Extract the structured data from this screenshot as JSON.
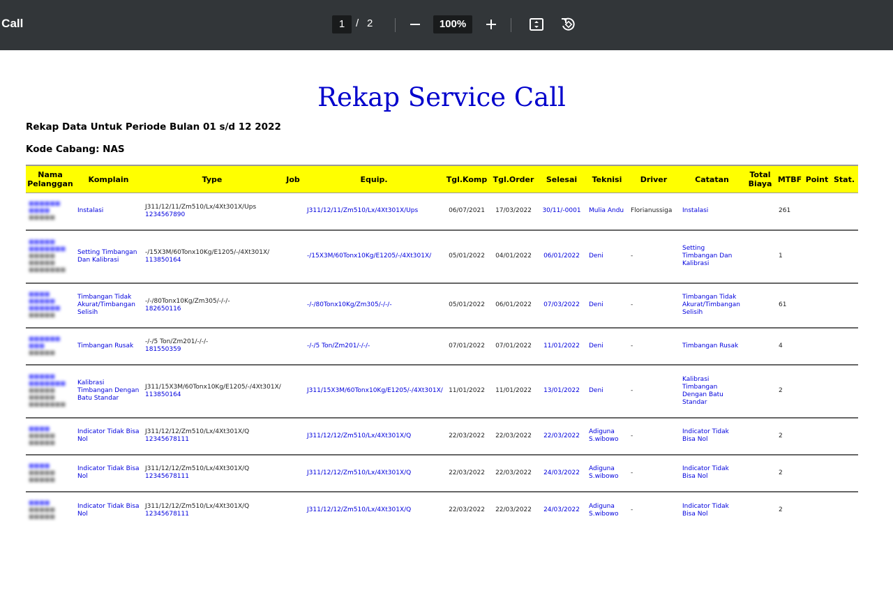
{
  "toolbar": {
    "doc_title": "e Call",
    "current_page": "1",
    "page_separator": "/",
    "total_pages": "2",
    "zoom": "100%",
    "zoom_out_icon": "minus-icon",
    "zoom_in_icon": "plus-icon",
    "fit_icon": "fit-to-page-icon",
    "rotate_icon": "rotate-icon"
  },
  "report": {
    "title": "Rekap Service Call",
    "period": "Rekap Data Untuk Periode Bulan 01 s/d 12 2022",
    "branch": "Kode Cabang: NAS"
  },
  "table": {
    "headers": [
      "Nama Pelanggan",
      "Komplain",
      "Type",
      "Job",
      "Equip.",
      "Tgl.Komp",
      "Tgl.Order",
      "Selesai",
      "Teknisi",
      "Driver",
      "Catatan",
      "Total Biaya",
      "MTBF",
      "Point",
      "Stat."
    ],
    "rows": [
      {
        "komplain": "Instalasi",
        "type": "J311/12/11/Zm510/Lx/4Xt301X/Ups",
        "type_id": "1234567890",
        "job": "",
        "equip": "J311/12/11/Zm510/Lx/4Xt301X/Ups",
        "tgl_komp": "06/07/2021",
        "tgl_order": "17/03/2022",
        "selesai": "30/11/-0001",
        "teknisi": "Mulia Andu",
        "driver": "Florianussiga",
        "catatan": "Instalasi",
        "total_biaya": "",
        "mtbf": "261",
        "point": "",
        "stat": ""
      },
      {
        "komplain": "Setting Timbangan Dan Kalibrasi",
        "type": "-/15X3M/60Tonx10Kg/E1205/-/4Xt301X/",
        "type_id": "113850164",
        "job": "",
        "equip": "-/15X3M/60Tonx10Kg/E1205/-/4Xt301X/",
        "tgl_komp": "05/01/2022",
        "tgl_order": "04/01/2022",
        "selesai": "06/01/2022",
        "teknisi": "Deni",
        "driver": "-",
        "catatan": "Setting Timbangan Dan Kalibrasi",
        "total_biaya": "",
        "mtbf": "1",
        "point": "",
        "stat": ""
      },
      {
        "komplain": "Timbangan Tidak Akurat/Timbangan Selisih",
        "type": "-/-/80Tonx10Kg/Zm305/-/-/-",
        "type_id": "182650116",
        "job": "",
        "equip": "-/-/80Tonx10Kg/Zm305/-/-/-",
        "tgl_komp": "05/01/2022",
        "tgl_order": "06/01/2022",
        "selesai": "07/03/2022",
        "teknisi": "Deni",
        "driver": "-",
        "catatan": "Timbangan Tidak Akurat/Timbangan Selisih",
        "total_biaya": "",
        "mtbf": "61",
        "point": "",
        "stat": ""
      },
      {
        "komplain": "Timbangan Rusak",
        "type": "-/-/5 Ton/Zm201/-/-/-",
        "type_id": "181550359",
        "job": "",
        "equip": "-/-/5 Ton/Zm201/-/-/-",
        "tgl_komp": "07/01/2022",
        "tgl_order": "07/01/2022",
        "selesai": "11/01/2022",
        "teknisi": "Deni",
        "driver": "-",
        "catatan": "Timbangan Rusak",
        "total_biaya": "",
        "mtbf": "4",
        "point": "",
        "stat": ""
      },
      {
        "komplain": "Kalibrasi Timbangan Dengan Batu Standar",
        "type": "J311/15X3M/60Tonx10Kg/E1205/-/4Xt301X/",
        "type_id": "113850164",
        "job": "",
        "equip": "J311/15X3M/60Tonx10Kg/E1205/-/4Xt301X/",
        "tgl_komp": "11/01/2022",
        "tgl_order": "11/01/2022",
        "selesai": "13/01/2022",
        "teknisi": "Deni",
        "driver": "-",
        "catatan": "Kalibrasi Timbangan Dengan Batu Standar",
        "total_biaya": "",
        "mtbf": "2",
        "point": "",
        "stat": ""
      },
      {
        "komplain": "Indicator Tidak Bisa Nol",
        "type": "J311/12/12/Zm510/Lx/4Xt301X/Q",
        "type_id": "12345678111",
        "job": "",
        "equip": "J311/12/12/Zm510/Lx/4Xt301X/Q",
        "tgl_komp": "22/03/2022",
        "tgl_order": "22/03/2022",
        "selesai": "22/03/2022",
        "teknisi": "Adiguna S.wibowo",
        "driver": "-",
        "catatan": "Indicator Tidak Bisa Nol",
        "total_biaya": "",
        "mtbf": "2",
        "point": "",
        "stat": ""
      },
      {
        "komplain": "Indicator Tidak Bisa Nol",
        "type": "J311/12/12/Zm510/Lx/4Xt301X/Q",
        "type_id": "12345678111",
        "job": "",
        "equip": "J311/12/12/Zm510/Lx/4Xt301X/Q",
        "tgl_komp": "22/03/2022",
        "tgl_order": "22/03/2022",
        "selesai": "24/03/2022",
        "teknisi": "Adiguna S.wibowo",
        "driver": "-",
        "catatan": "Indicator Tidak Bisa Nol",
        "total_biaya": "",
        "mtbf": "2",
        "point": "",
        "stat": ""
      },
      {
        "komplain": "Indicator Tidak Bisa Nol",
        "type": "J311/12/12/Zm510/Lx/4Xt301X/Q",
        "type_id": "12345678111",
        "job": "",
        "equip": "J311/12/12/Zm510/Lx/4Xt301X/Q",
        "tgl_komp": "22/03/2022",
        "tgl_order": "22/03/2022",
        "selesai": "24/03/2022",
        "teknisi": "Adiguna S.wibowo",
        "driver": "-",
        "catatan": "Indicator Tidak Bisa Nol",
        "total_biaya": "",
        "mtbf": "2",
        "point": "",
        "stat": ""
      }
    ]
  },
  "colors": {
    "toolbar_bg": "#323639",
    "header_bg": "#ffff00",
    "title_blue": "#0000cc",
    "link_blue": "#0000dd"
  }
}
